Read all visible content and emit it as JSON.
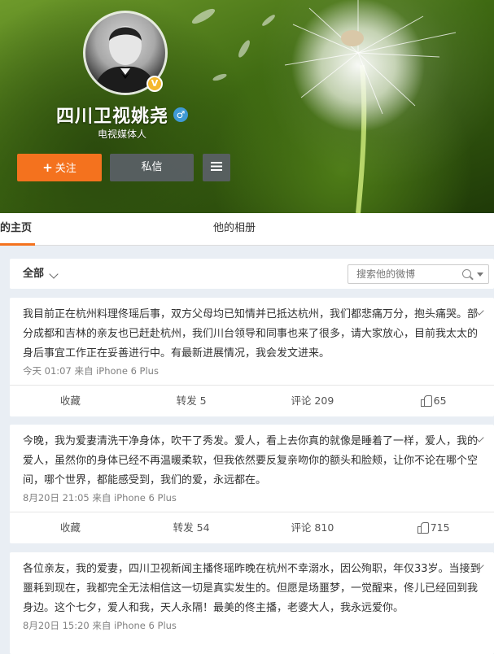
{
  "profile": {
    "name": "四川卫视姚尧",
    "gender_symbol": "♂",
    "verified_symbol": "V",
    "subtitle": "电视媒体人",
    "follow_label": "关注",
    "follow_plus": "+",
    "message_label": "私信"
  },
  "tabs": {
    "home": "的主页",
    "album": "他的相册"
  },
  "filter": {
    "all_label": "全部",
    "search_placeholder": "搜索他的微博"
  },
  "posts": [
    {
      "text": "我目前正在杭州料理佟瑶后事，双方父母均已知情并已抵达杭州，我们都悲痛万分，抱头痛哭。部分成都和吉林的亲友也已赶赴杭州，我们川台领导和同事也来了很多，请大家放心，目前我太太的身后事宜工作正在妥善进行中。有最新进展情况，我会发文进来。",
      "meta": "今天 01:07 来自 iPhone 6 Plus",
      "fav": "收藏",
      "repost": "转发 5",
      "comment": "评论 209",
      "like": "65"
    },
    {
      "text": "今晚，我为爱妻清洗干净身体，吹干了秀发。爱人，看上去你真的就像是睡着了一样，爱人，我的爱人，虽然你的身体已经不再温暖柔软，但我依然要反复亲吻你的额头和脸颊，让你不论在哪个空间，哪个世界，都能感受到，我们的爱，永远都在。",
      "meta": "8月20日 21:05 来自 iPhone 6 Plus",
      "fav": "收藏",
      "repost": "转发 54",
      "comment": "评论 810",
      "like": "715"
    },
    {
      "text": "各位亲友，我的爱妻，四川卫视新闻主播佟瑶昨晚在杭州不幸溺水，因公殉职，年仅33岁。当接到噩耗到现在，我都完全无法相信这一切是真实发生的。但愿是场噩梦，一觉醒来，佟儿已经回到我身边。这个七夕，爱人和我，天人永隔！最美的佟主播，老婆大人，我永远爱你。",
      "meta": "8月20日 15:20 来自 iPhone 6 Plus"
    }
  ],
  "colors": {
    "accent_orange": "#f4721e",
    "page_bg": "#e9eef4",
    "verified_gold": "#f5b82e",
    "male_blue": "#3f9ad6"
  }
}
